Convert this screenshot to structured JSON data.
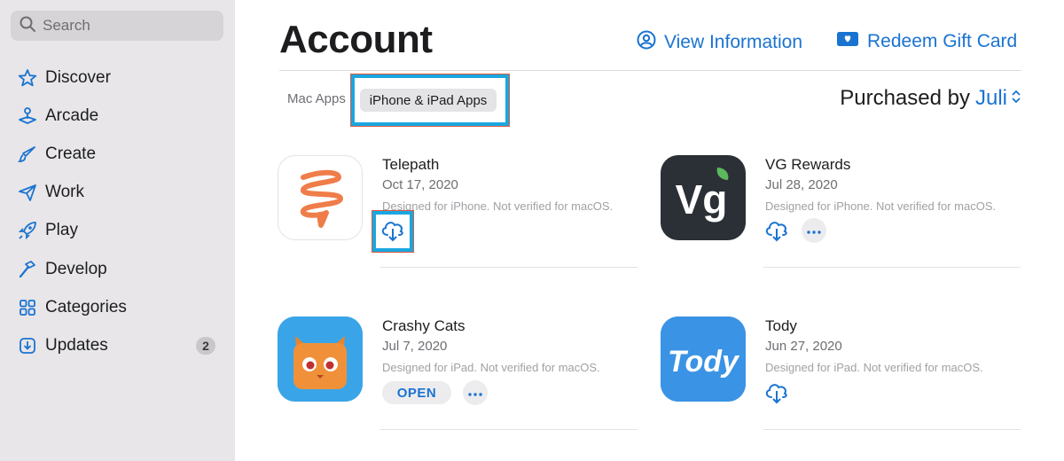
{
  "sidebar": {
    "search": {
      "label": "Search",
      "icon": "search-icon"
    },
    "items": [
      {
        "label": "Discover",
        "icon": "star-icon"
      },
      {
        "label": "Arcade",
        "icon": "joystick-icon"
      },
      {
        "label": "Create",
        "icon": "brush-icon"
      },
      {
        "label": "Work",
        "icon": "paper-plane-icon"
      },
      {
        "label": "Play",
        "icon": "rocket-icon"
      },
      {
        "label": "Develop",
        "icon": "hammer-icon"
      },
      {
        "label": "Categories",
        "icon": "grid-icon"
      },
      {
        "label": "Updates",
        "icon": "download-icon",
        "badge": "2"
      }
    ]
  },
  "header": {
    "title": "Account",
    "view_information": "View Information",
    "redeem_gift_card": "Redeem Gift Card"
  },
  "tabs": {
    "mac": "Mac Apps",
    "iphone": "iPhone & iPad Apps"
  },
  "purchased": {
    "label": "Purchased by",
    "user": "Juli"
  },
  "apps": [
    {
      "name": "Telepath",
      "date": "Oct 17, 2020",
      "note": "Designed for iPhone. Not verified for macOS.",
      "action": "download"
    },
    {
      "name": "VG Rewards",
      "date": "Jul 28, 2020",
      "note": "Designed for iPhone. Not verified for macOS.",
      "action": "download"
    },
    {
      "name": "Crashy Cats",
      "date": "Jul 7, 2020",
      "note": "Designed for iPad. Not verified for macOS.",
      "action": "open",
      "open_label": "OPEN"
    },
    {
      "name": "Tody",
      "date": "Jun 27, 2020",
      "note": "Designed for iPad. Not verified for macOS.",
      "action": "download"
    }
  ],
  "icon_text": {
    "vg": "Vg",
    "tody": "Tody"
  },
  "colors": {
    "accent": "#1a73d1",
    "highlight": "#1aa7e0",
    "sidebar": "#e8e6e8"
  }
}
